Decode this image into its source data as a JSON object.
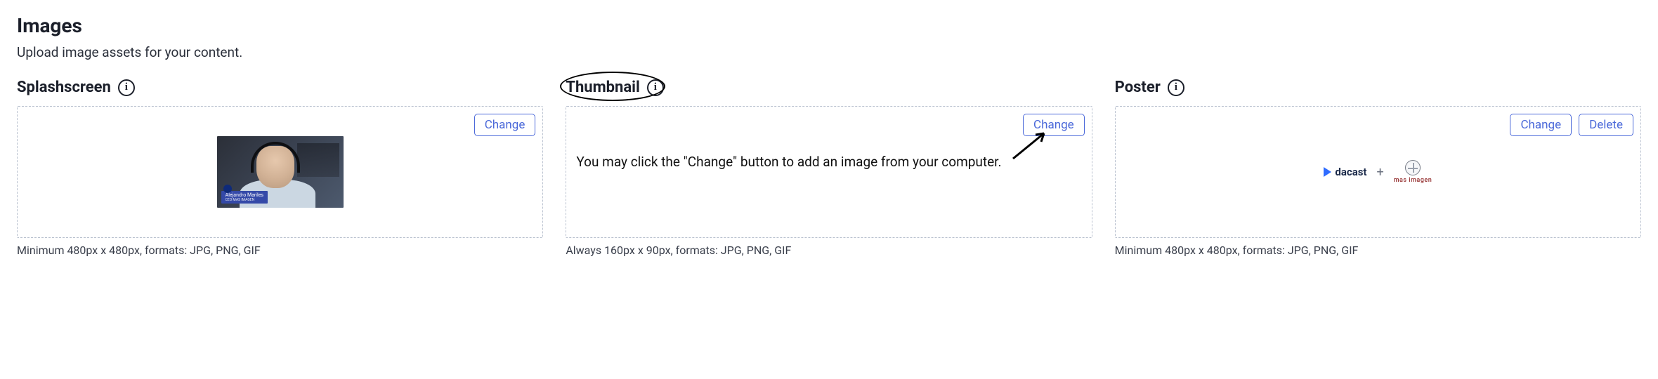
{
  "section": {
    "title": "Images",
    "description": "Upload image assets for your content."
  },
  "cards": {
    "splashscreen": {
      "title": "Splashscreen",
      "change_label": "Change",
      "helper": "Minimum 480px x 480px, formats: JPG, PNG, GIF",
      "preview_name": "Alejandro Mariles",
      "preview_subtitle": "CEO MAS IMAGEN"
    },
    "thumbnail": {
      "title": "Thumbnail",
      "change_label": "Change",
      "helper": "Always 160px x 90px, formats: JPG, PNG, GIF",
      "instruction": "You may click the \"Change\" button to add an image from your computer."
    },
    "poster": {
      "title": "Poster",
      "change_label": "Change",
      "delete_label": "Delete",
      "helper": "Minimum 480px x 480px, formats: JPG, PNG, GIF",
      "logo1": "dacast",
      "logo2": "mas imagen"
    }
  },
  "glyphs": {
    "info": "i",
    "plus": "+"
  }
}
